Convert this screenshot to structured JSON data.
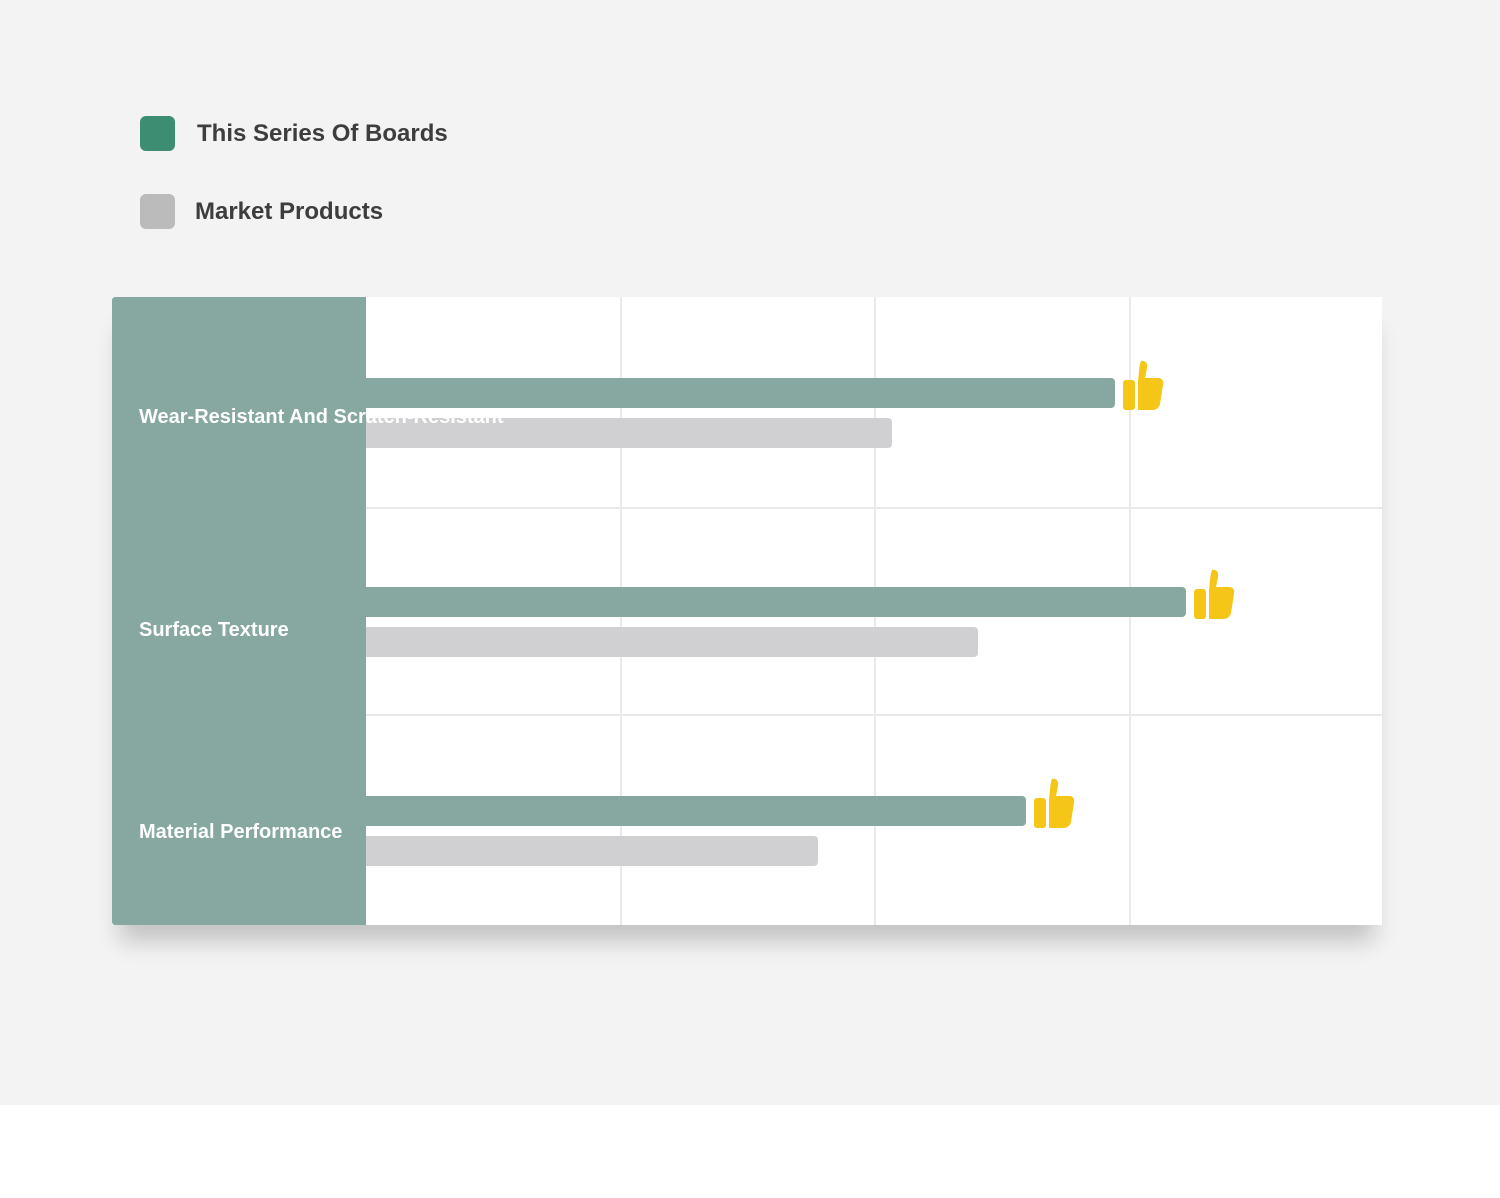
{
  "chart_data": {
    "type": "bar",
    "orientation": "horizontal",
    "categories": [
      "Wear-Resistant And Scratch-Resistant",
      "Surface Texture",
      "Material Performance"
    ],
    "series": [
      {
        "name": "This Series Of Boards",
        "values": [
          2.95,
          3.23,
          2.6
        ],
        "color": "#3d8d72",
        "bar_color": "#86a8a0"
      },
      {
        "name": "Market Products",
        "values": [
          2.07,
          2.41,
          1.78
        ],
        "color": "#bbbbbb",
        "bar_color": "#d0d0d2"
      }
    ],
    "xlim": [
      0,
      4
    ],
    "grid": true,
    "legend_position": "top-left",
    "winner_icon": "thumbs-up-icon",
    "icon_color": "#f5c518",
    "category_column_color": "#86a8a0"
  }
}
